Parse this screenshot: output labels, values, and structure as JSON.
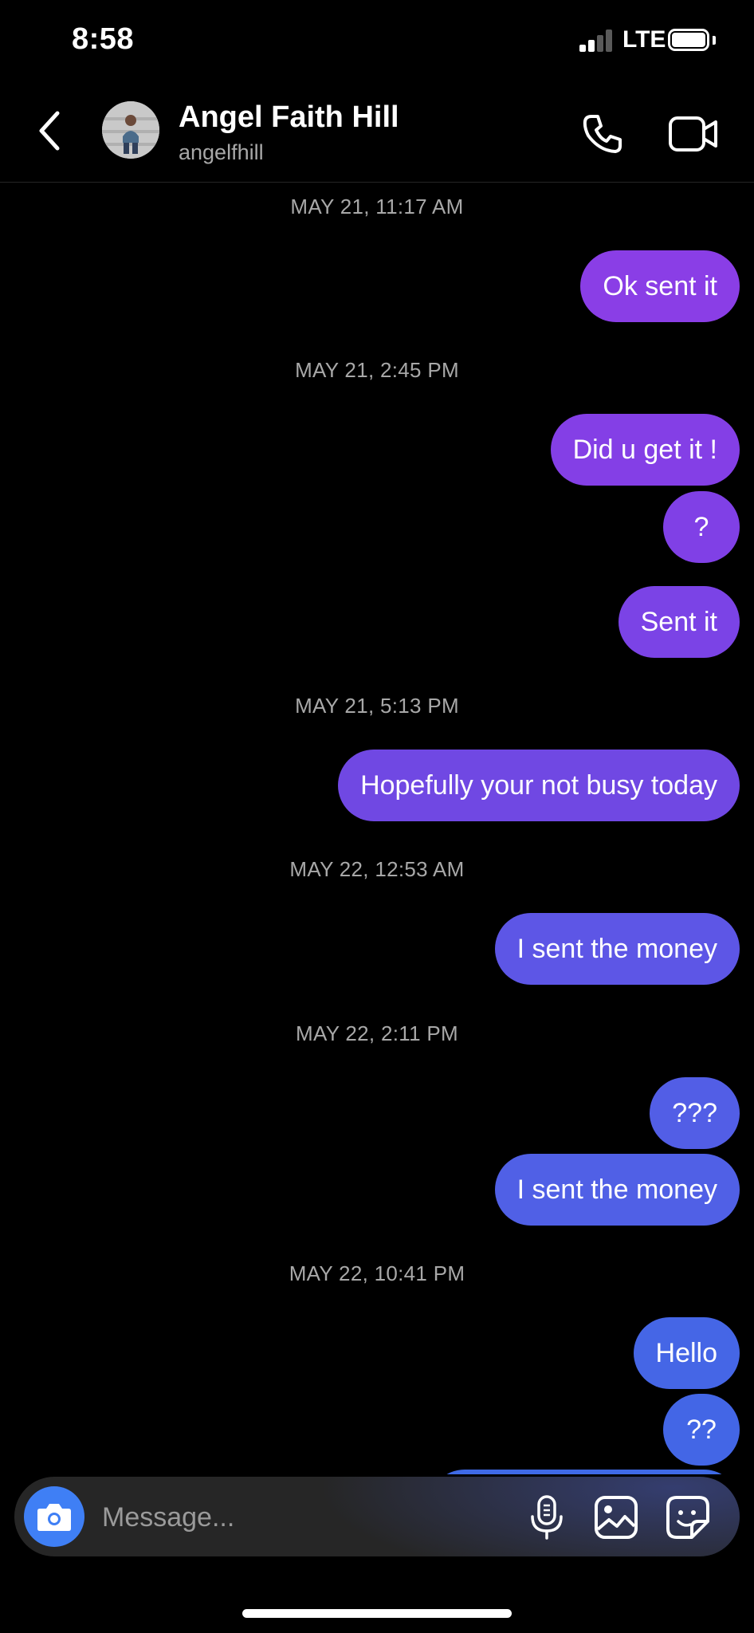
{
  "status_bar": {
    "time": "8:58",
    "network": "LTE",
    "signal_bars_filled": 2,
    "signal_bars_total": 4,
    "battery_level": 1.0
  },
  "header": {
    "contact_name": "Angel Faith Hill",
    "contact_handle": "angelfhill",
    "icons": {
      "back": "chevron-left-icon",
      "call": "phone-icon",
      "video": "video-camera-icon"
    }
  },
  "messages": [
    {
      "timestamp": "MAY 21, 11:17 AM"
    },
    {
      "text": "Ok sent it",
      "color": "#8a3ee6"
    },
    {
      "timestamp": "MAY 21, 2:45 PM"
    },
    {
      "text": "Did u get it !",
      "color": "#843fe6"
    },
    {
      "text": "?",
      "color": "#8040e6"
    },
    {
      "text": "Sent it",
      "color": "#7b43e6"
    },
    {
      "timestamp": "MAY 21, 5:13 PM"
    },
    {
      "text": "Hopefully your not busy today",
      "color": "#7048e3"
    },
    {
      "timestamp": "MAY 22, 12:53 AM"
    },
    {
      "text": "I sent the money",
      "color": "#5d56e6"
    },
    {
      "timestamp": "MAY 22, 2:11 PM"
    },
    {
      "text": "???",
      "color": "#525ee6"
    },
    {
      "text": "I sent the money",
      "color": "#5060e6"
    },
    {
      "timestamp": "MAY 22, 10:41 PM"
    },
    {
      "text": "Hello",
      "color": "#4566e6"
    },
    {
      "text": "??",
      "color": "#4366e6"
    },
    {
      "text": "",
      "color": "#3f6ae6"
    }
  ],
  "composer": {
    "placeholder": "Message...",
    "accent": "#3f7ff5",
    "icons": {
      "camera": "camera-icon",
      "mic": "microphone-icon",
      "gallery": "image-icon",
      "sticker": "sticker-icon"
    }
  }
}
